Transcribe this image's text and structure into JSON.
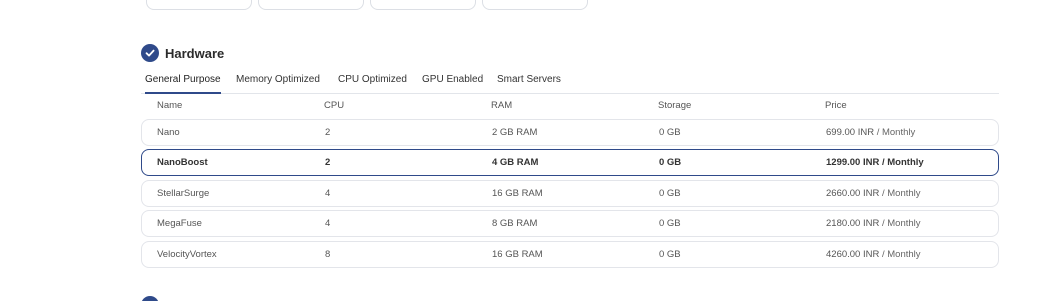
{
  "section": {
    "title": "Hardware"
  },
  "tabs": [
    {
      "label": "General Purpose",
      "active": true
    },
    {
      "label": "Memory Optimized",
      "active": false
    },
    {
      "label": "CPU Optimized",
      "active": false
    },
    {
      "label": "GPU Enabled",
      "active": false
    },
    {
      "label": "Smart Servers",
      "active": false
    }
  ],
  "table": {
    "headers": {
      "name": "Name",
      "cpu": "CPU",
      "ram": "RAM",
      "storage": "Storage",
      "price": "Price"
    },
    "rows": [
      {
        "name": "Nano",
        "cpu": "2",
        "ram": "2 GB RAM",
        "storage": "0 GB",
        "price": "699.00 INR",
        "period": "/ Monthly",
        "selected": false
      },
      {
        "name": "NanoBoost",
        "cpu": "2",
        "ram": "4 GB RAM",
        "storage": "0 GB",
        "price": "1299.00 INR",
        "period": "/ Monthly",
        "selected": true
      },
      {
        "name": "StellarSurge",
        "cpu": "4",
        "ram": "16 GB RAM",
        "storage": "0 GB",
        "price": "2660.00 INR",
        "period": "/ Monthly",
        "selected": false
      },
      {
        "name": "MegaFuse",
        "cpu": "4",
        "ram": "8 GB RAM",
        "storage": "0 GB",
        "price": "2180.00 INR",
        "period": "/ Monthly",
        "selected": false
      },
      {
        "name": "VelocityVortex",
        "cpu": "8",
        "ram": "16 GB RAM",
        "storage": "0 GB",
        "price": "4260.00 INR",
        "period": "/ Monthly",
        "selected": false
      }
    ]
  },
  "colors": {
    "accent": "#2f4a8a",
    "border": "#e3e5ea"
  },
  "icons": {
    "section": "check-circle-icon"
  }
}
